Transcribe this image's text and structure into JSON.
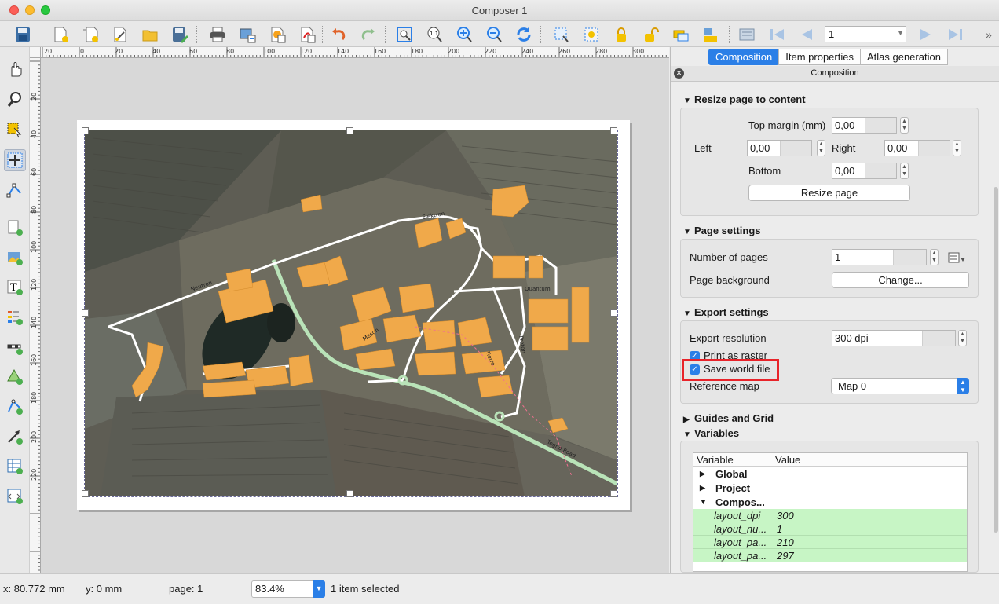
{
  "window": {
    "title": "Composer 1"
  },
  "toolbar": {
    "page_number": "1",
    "icons": [
      "save-icon",
      "new-composer-icon",
      "duplicate-composer-icon",
      "composer-manager-icon",
      "open-template-icon",
      "save-template-icon",
      "print-icon",
      "export-image-icon",
      "export-svg-icon",
      "export-pdf-icon",
      "undo-icon",
      "redo-icon",
      "zoom-full-icon",
      "zoom-actual-icon",
      "zoom-in-icon",
      "zoom-out-icon",
      "refresh-icon",
      "select-icon",
      "deselect-icon",
      "lock-icon",
      "unlock-icon",
      "raise-icon",
      "align-icon",
      "atlas-preview-icon",
      "first-feature-icon",
      "prev-feature-icon",
      "next-feature-icon",
      "last-feature-icon"
    ]
  },
  "rulers": {
    "top": [
      "20",
      "0",
      "20",
      "40",
      "60",
      "80",
      "100",
      "120",
      "140",
      "160",
      "180",
      "200",
      "220",
      "240",
      "260",
      "280",
      "300"
    ],
    "left": [
      "20",
      "40",
      "60",
      "80",
      "100",
      "120",
      "140",
      "160",
      "180",
      "200",
      "220"
    ]
  },
  "map": {
    "streets": [
      "Elektron",
      "Neutron",
      "Quantum",
      "Meson",
      "Proton",
      "Tierre",
      "Tegno Road"
    ]
  },
  "panel": {
    "tabs": [
      "Composition",
      "Item properties",
      "Atlas generation"
    ],
    "dock_title": "Composition",
    "resize": {
      "header": "Resize page to content",
      "top_margin_label": "Top margin (mm)",
      "top_value": "0,00",
      "left_label": "Left",
      "left_value": "0,00",
      "right_label": "Right",
      "right_value": "0,00",
      "bottom_label": "Bottom",
      "bottom_value": "0,00",
      "button": "Resize page"
    },
    "page_settings": {
      "header": "Page settings",
      "pages_label": "Number of pages",
      "pages_value": "1",
      "background_label": "Page background",
      "change_button": "Change..."
    },
    "export": {
      "header": "Export settings",
      "resolution_label": "Export resolution",
      "resolution_value": "300 dpi",
      "raster_label": "Print as raster",
      "world_file_label": "Save world file",
      "ref_map_label": "Reference map",
      "ref_map_value": "Map 0"
    },
    "guides_header": "Guides and Grid",
    "variables": {
      "header": "Variables",
      "col_variable": "Variable",
      "col_value": "Value",
      "groups": [
        "Global",
        "Project",
        "Compos..."
      ],
      "rows": [
        {
          "name": "layout_dpi",
          "value": "300"
        },
        {
          "name": "layout_nu...",
          "value": "1"
        },
        {
          "name": "layout_pa...",
          "value": "210"
        },
        {
          "name": "layout_pa...",
          "value": "297"
        }
      ]
    }
  },
  "status": {
    "x": "x: 80.772 mm",
    "y": "y: 0 mm",
    "page": "page: 1",
    "zoom": "83.4%",
    "selection": "1 item selected"
  },
  "colors": {
    "accent": "#2b7fe7",
    "highlight": "#e8242a",
    "building": "#f0a94a",
    "road": "#ffffff",
    "main_road": "#b9e3b8"
  }
}
